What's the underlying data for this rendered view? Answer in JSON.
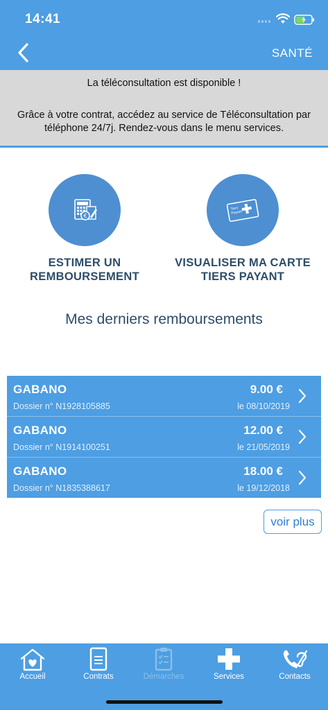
{
  "status_bar": {
    "time": "14:41"
  },
  "header": {
    "title": "SANTÉ"
  },
  "banner": {
    "title": "La téléconsultation est disponible !",
    "text": "Grâce à votre contrat, accédez au service de Téléconsultation par téléphone 24/7j. Rendez-vous dans le menu services."
  },
  "actions": [
    {
      "line1": "ESTIMER UN",
      "line2": "REMBOURSEMENT",
      "icon": "calculator-document-icon"
    },
    {
      "line1": "VISUALISER MA CARTE",
      "line2": "TIERS PAYANT",
      "icon": "tiers-payant-card-icon",
      "card_text": "Tiers Payant"
    }
  ],
  "section_title": "Mes derniers remboursements",
  "reimbursements": [
    {
      "name": "GABANO",
      "dossier": "Dossier n° N1928105885",
      "amount": "9.00 €",
      "date": "le 08/10/2019"
    },
    {
      "name": "GABANO",
      "dossier": "Dossier n° N1914100251",
      "amount": "12.00 €",
      "date": "le 21/05/2019"
    },
    {
      "name": "GABANO",
      "dossier": "Dossier n° N1835388617",
      "amount": "18.00 €",
      "date": "le 19/12/2018"
    }
  ],
  "voir_plus": "voir plus",
  "tabs": [
    {
      "label": "Accueil",
      "icon": "home-heart-icon",
      "enabled": true
    },
    {
      "label": "Contrats",
      "icon": "document-icon",
      "enabled": true
    },
    {
      "label": "Démarches",
      "icon": "clipboard-checklist-icon",
      "enabled": false
    },
    {
      "label": "Services",
      "icon": "medical-cross-icon",
      "enabled": true
    },
    {
      "label": "Contacts",
      "icon": "phone-hearing-icon",
      "enabled": true
    }
  ],
  "colors": {
    "primary": "#4d9ee3",
    "banner_bg": "#d8d8d8",
    "heading": "#2e4d68",
    "circle": "#4d8fd1"
  }
}
